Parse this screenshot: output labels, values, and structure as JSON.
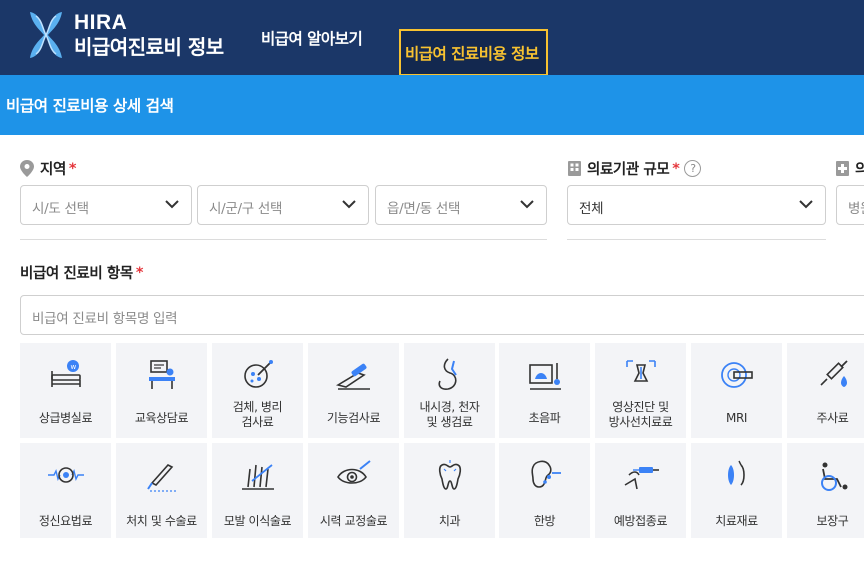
{
  "header": {
    "brand_en": "HIRA",
    "brand_ko": "비급여진료비 정보",
    "nav": [
      "비급여 알아보기",
      "비급여 진료비용 정보"
    ],
    "active_color": "#f7c231"
  },
  "band": {
    "title": "비급여 진료비용 상세 검색"
  },
  "region": {
    "label": "지역",
    "required": "*",
    "selects": [
      "시/도 선택",
      "시/군/구 선택",
      "읍/면/동 선택"
    ]
  },
  "institution": {
    "label": "의료기관 규모",
    "required": "*",
    "help": "?",
    "value": "전체"
  },
  "hospital": {
    "label": "의",
    "placeholder": "병원"
  },
  "items": {
    "label": "비급여 진료비 항목",
    "required": "*",
    "placeholder": "비급여 진료비 항목명 입력",
    "categories": [
      "상급병실료",
      "교육상담료",
      "검체, 병리\n검사료",
      "기능검사료",
      "내시경, 천자\n및 생검료",
      "초음파",
      "영상진단 및\n방사선치료료",
      "MRI",
      "주사료",
      "정신요법료",
      "처치 및 수술료",
      "모발 이식술료",
      "시력 교정술료",
      "치과",
      "한방",
      "예방접종료",
      "치료재료",
      "보장구"
    ]
  },
  "colors": {
    "header_bg": "#1b3768",
    "band_bg": "#1e93e8",
    "icon_blue": "#3b82f6",
    "required_red": "#e5363c"
  }
}
